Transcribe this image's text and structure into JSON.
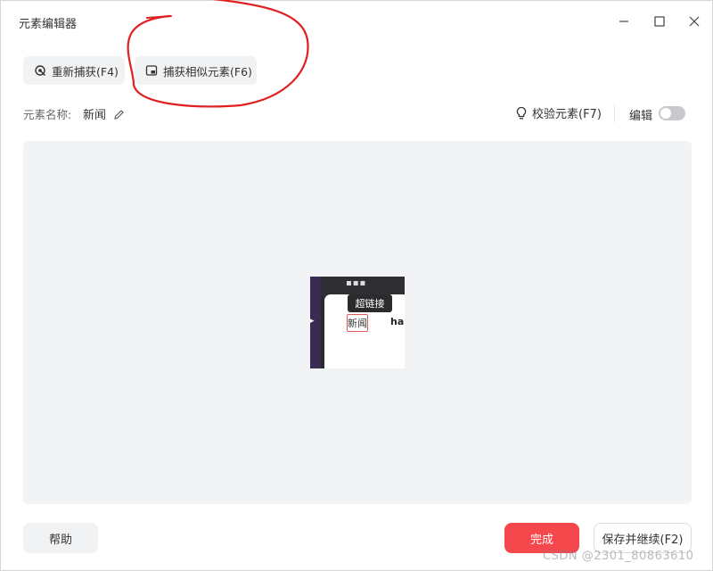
{
  "window": {
    "title": "元素编辑器"
  },
  "toolbar": {
    "recapture_label": "重新捕获(F4)",
    "capture_similar_label": "捕获相似元素(F6)"
  },
  "element": {
    "name_label": "元素名称:",
    "name_value": "新闻"
  },
  "actions": {
    "verify_label": "校验元素(F7)",
    "edit_label": "编辑",
    "edit_toggle_on": false
  },
  "preview": {
    "tooltip_text": "超链接",
    "highlighted_text": "新闻",
    "next_link_text": "ha"
  },
  "footer": {
    "help_label": "帮助",
    "done_label": "完成",
    "save_continue_label": "保存并继续(F2)"
  },
  "watermark": "CSDN @2301_80863610",
  "colors": {
    "primary_red": "#f5484d",
    "annotation_red": "#e02020",
    "preview_bg": "#f2f3f5"
  }
}
